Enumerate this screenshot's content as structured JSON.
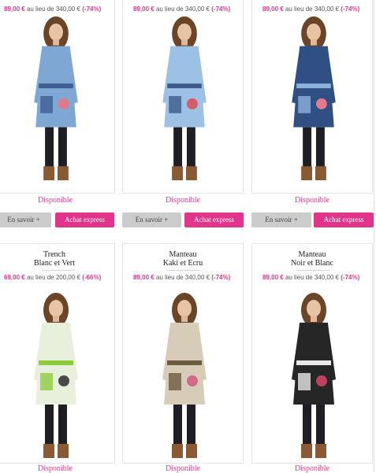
{
  "products": [
    {
      "price": "89,00 €",
      "orig": "au lieu de 340,00 €",
      "disc": "(-74%)",
      "status": "Disponible",
      "btn_info": "En savoir +",
      "btn_buy": "Achat express",
      "coat": "#7ea7d3",
      "accent": "#3e5f95",
      "trim": "#e07a8a"
    },
    {
      "price": "89,00 €",
      "orig": "au lieu de 340,00 €",
      "disc": "(-74%)",
      "status": "Disponible",
      "btn_info": "En savoir +",
      "btn_buy": "Achat express",
      "coat": "#9cc1e4",
      "accent": "#3f5a8a",
      "trim": "#d45c6c"
    },
    {
      "price": "89,00 €",
      "orig": "au lieu de 340,00 €",
      "disc": "(-74%)",
      "status": "Disponible",
      "btn_info": "En savoir +",
      "btn_buy": "Achat express",
      "coat": "#2f4f85",
      "accent": "#8db2da",
      "trim": "#e27a8c"
    },
    {
      "title1": "Trench",
      "title2": "Blanc et Vert",
      "price": "69,00 €",
      "orig": "au lieu de 200,00 €",
      "disc": "(-66%)",
      "status": "Disponible",
      "coat": "#e8f0dc",
      "accent": "#8ccc3c",
      "trim": "#4a4a4a"
    },
    {
      "title1": "Manteau",
      "title2": "Kaki et Ecru",
      "price": "89,00 €",
      "orig": "au lieu de 340,00 €",
      "disc": "(-74%)",
      "status": "Disponible",
      "coat": "#d6ccb8",
      "accent": "#6b5a3e",
      "trim": "#d06a86"
    },
    {
      "title1": "Manteau",
      "title2": "Noir et Blanc",
      "price": "89,00 €",
      "orig": "au lieu de 340,00 €",
      "disc": "(-74%)",
      "status": "Disponible",
      "coat": "#262626",
      "accent": "#e8e8e8",
      "trim": "#c04060"
    }
  ]
}
